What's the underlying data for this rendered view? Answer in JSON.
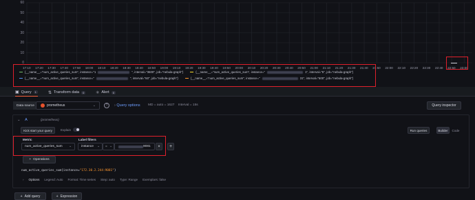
{
  "chart": {
    "y_ticks": [
      "60",
      "50",
      "40",
      "30",
      "20",
      "10",
      "0"
    ],
    "x_ticks": [
      "17:10",
      "17:20",
      "17:30",
      "17:40",
      "17:50",
      "18:00",
      "18:10",
      "18:20",
      "18:30",
      "18:40",
      "18:50",
      "19:00",
      "19:10",
      "19:20",
      "19:30",
      "19:40",
      "19:50",
      "20:00",
      "20:10",
      "20:20",
      "20:30",
      "20:40",
      "20:50",
      "21:00",
      "21:10",
      "21:20",
      "21:30",
      "21:40",
      "21:50",
      "22:00",
      "22:10",
      "22:20",
      "22:30",
      "22:40",
      "22:50",
      "23:00"
    ],
    "legend": [
      {
        "color": "#73bf69",
        "text_a": "{__name__=\"num_active_queries_sum\", instance=\"1",
        "text_b": "\", interval=\"3600\", job=\"nebula-graph\"}"
      },
      {
        "color": "#fade2a",
        "text_a": "{__name__=\"num_active_queries_sum\", instance=\"",
        "text_b": "1\", interval=\"5\", job=\"nebula-graph\"}"
      },
      {
        "color": "#5794f2",
        "text_a": "{__name__=\"num_active_queries_sum\", instance=\"",
        "text_b": "\", interval=\"60\", job=\"nebula-graph\"}"
      },
      {
        "color": "#ff9830",
        "text_a": "{__name__=\"num_active_queries_sum\", instance=\"",
        "text_b": "31\", interval=\"600\", job=\"nebula-graph\"}"
      }
    ]
  },
  "tabs": [
    {
      "label": "Query",
      "badge": "1"
    },
    {
      "label": "Transform data",
      "badge": "0"
    },
    {
      "label": "Alert",
      "badge": "0"
    }
  ],
  "query_header": {
    "datasource_label": "Data source",
    "datasource_value": "prometheus",
    "query_options_label": "Query options",
    "query_options_info": "MD = auto = 1627    Interval = 15s",
    "inspector_label": "Query inspector"
  },
  "query_row": {
    "letter": "A",
    "source_hint": "(prometheus)",
    "kickstart_label": "Kick start your query",
    "explain_label": "Explain",
    "run_label": "Run queries",
    "builder_label": "Builder",
    "code_label": "Code"
  },
  "builder": {
    "metric_label": "Metric",
    "metric_value": "num_active_queries_sum",
    "label_filters_label": "Label filters",
    "filter_key": "instance",
    "filter_op": "=",
    "filter_value_tail": "9081",
    "operations_label": "Operations"
  },
  "promql": {
    "metric": "num_active_queries_sum",
    "open": "{instance=",
    "value": "\"172.30.2.244:9081\"",
    "close": "}"
  },
  "options_row": {
    "label": "Options",
    "legend": "Legend: Auto",
    "format": "Format: Time series",
    "step": "Step: auto",
    "type": "Type: Range",
    "exemplars": "Exemplars: false"
  },
  "footer": {
    "add_query": "Add query",
    "expression": "Expression"
  }
}
